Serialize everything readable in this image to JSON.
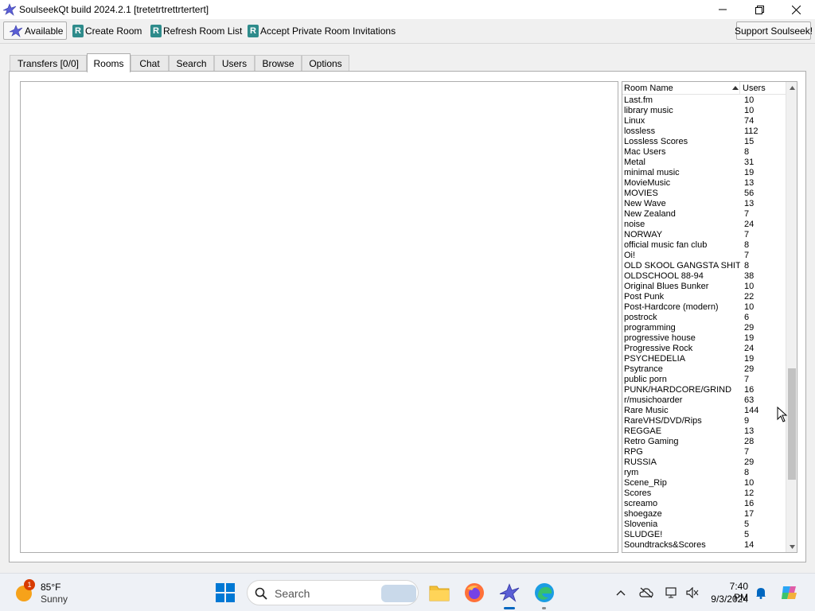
{
  "window": {
    "title": "SoulseekQt build 2024.2.1 [tretetrtrettrtertert]"
  },
  "toolbar": {
    "available_label": "Available",
    "create_room_label": "Create Room",
    "refresh_room_list_label": "Refresh Room List",
    "accept_invitations_label": "Accept Private Room Invitations",
    "support_label": "Support Soulseek!",
    "room_icon_letter": "R"
  },
  "tabs": [
    {
      "label": "Transfers [0/0]",
      "active": false
    },
    {
      "label": "Rooms",
      "active": true
    },
    {
      "label": "Chat",
      "active": false
    },
    {
      "label": "Search",
      "active": false
    },
    {
      "label": "Users",
      "active": false
    },
    {
      "label": "Browse",
      "active": false
    },
    {
      "label": "Options",
      "active": false
    }
  ],
  "room_list": {
    "columns": {
      "name": "Room Name",
      "users": "Users"
    },
    "sort": {
      "column": "name",
      "direction": "ascending"
    },
    "rows": [
      {
        "name": "Last.fm",
        "users": "10"
      },
      {
        "name": "library music",
        "users": "10"
      },
      {
        "name": "Linux",
        "users": "74"
      },
      {
        "name": "lossless",
        "users": "112"
      },
      {
        "name": "Lossless Scores",
        "users": "15"
      },
      {
        "name": "Mac Users",
        "users": "8"
      },
      {
        "name": "Metal",
        "users": "31"
      },
      {
        "name": "minimal music",
        "users": "19"
      },
      {
        "name": "MovieMusic",
        "users": "13"
      },
      {
        "name": "MOVIES",
        "users": "56"
      },
      {
        "name": "New Wave",
        "users": "13"
      },
      {
        "name": "New Zealand",
        "users": "7"
      },
      {
        "name": "noise",
        "users": "24"
      },
      {
        "name": "NORWAY",
        "users": "7"
      },
      {
        "name": "official music fan club",
        "users": "8"
      },
      {
        "name": "Oi!",
        "users": "7"
      },
      {
        "name": "OLD SKOOL GANGSTA SHIT",
        "users": "8"
      },
      {
        "name": "OLDSCHOOL 88-94",
        "users": "38"
      },
      {
        "name": "Original Blues Bunker",
        "users": "10"
      },
      {
        "name": "Post Punk",
        "users": "22"
      },
      {
        "name": "Post-Hardcore (modern)",
        "users": "10"
      },
      {
        "name": "postrock",
        "users": "6"
      },
      {
        "name": "programming",
        "users": "29"
      },
      {
        "name": "progressive house",
        "users": "19"
      },
      {
        "name": "Progressive Rock",
        "users": "24"
      },
      {
        "name": "PSYCHEDELIA",
        "users": "19"
      },
      {
        "name": "Psytrance",
        "users": "29"
      },
      {
        "name": "public porn",
        "users": "7"
      },
      {
        "name": "PUNK/HARDCORE/GRIND",
        "users": "16"
      },
      {
        "name": "r/musichoarder",
        "users": "63"
      },
      {
        "name": "Rare Music",
        "users": "144"
      },
      {
        "name": "RareVHS/DVD/Rips",
        "users": "9"
      },
      {
        "name": "REGGAE",
        "users": "13"
      },
      {
        "name": "Retro Gaming",
        "users": "28"
      },
      {
        "name": "RPG",
        "users": "7"
      },
      {
        "name": "RUSSIA",
        "users": "29"
      },
      {
        "name": "rym",
        "users": "8"
      },
      {
        "name": "Scene_Rip",
        "users": "10"
      },
      {
        "name": "Scores",
        "users": "12"
      },
      {
        "name": "screamo",
        "users": "16"
      },
      {
        "name": "shoegaze",
        "users": "17"
      },
      {
        "name": "Slovenia",
        "users": "5"
      },
      {
        "name": "SLUDGE!",
        "users": "5"
      },
      {
        "name": "Soundtracks&Scores",
        "users": "14"
      }
    ]
  },
  "taskbar": {
    "weather": {
      "temperature": "85°F",
      "condition": "Sunny",
      "badge": "1"
    },
    "search_label": "Search",
    "time": "7:40 PM",
    "date": "9/3/2024"
  },
  "colors": {
    "accent": "#0067c0",
    "room_icon": "#2e8b8b",
    "weather_sun": "#f6a21a",
    "badge": "#d83b01"
  },
  "icons": {
    "app": "soulseek-bird-icon",
    "minimize": "minimize-icon",
    "maximize": "maximize-icon",
    "close": "close-icon",
    "sort": "sort-ascending-icon",
    "start": "windows-start-icon",
    "search": "search-icon",
    "explorer": "file-explorer-icon",
    "firefox": "firefox-icon",
    "edge": "edge-icon"
  }
}
